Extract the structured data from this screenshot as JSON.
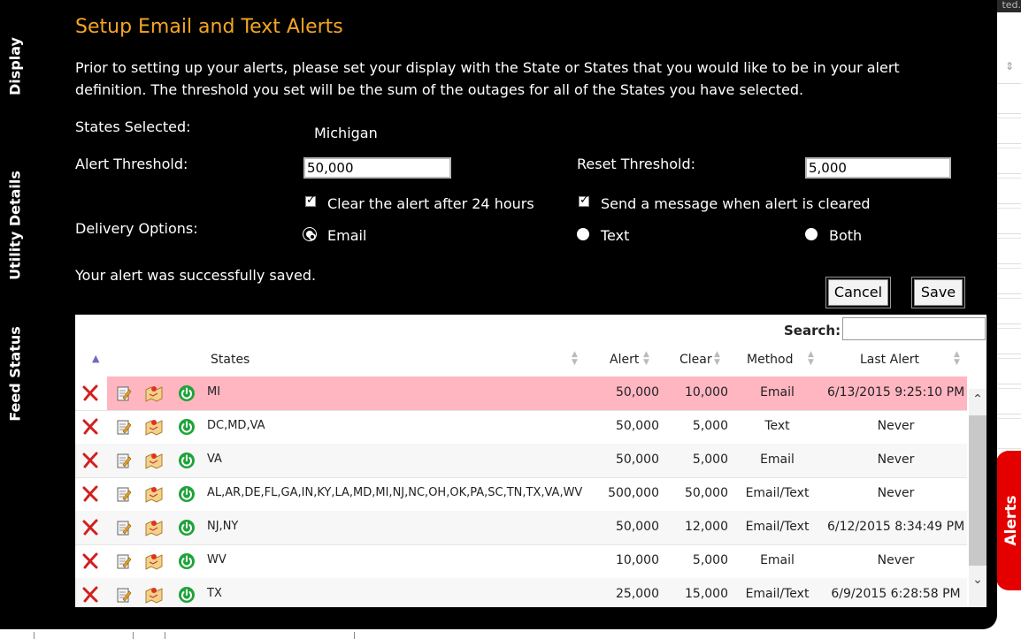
{
  "dialog": {
    "title": "Setup Email and Text Alerts",
    "intro": "Prior to setting up your alerts, please set your display with the State or States that you would like to be in your alert definition. The threshold you set will be the sum of the outages for all of the States you have selected.",
    "states_selected_label": "States Selected:",
    "states_selected_value": "Michigan",
    "alert_threshold_label": "Alert Threshold:",
    "alert_threshold_value": "50,000",
    "reset_threshold_label": "Reset Threshold:",
    "reset_threshold_value": "5,000",
    "clear_after_label": "Clear the alert after 24 hours",
    "send_cleared_label": "Send a message when alert is cleared",
    "delivery_label": "Delivery Options:",
    "delivery_options": [
      "Email",
      "Text",
      "Both"
    ],
    "delivery_selected": "Email",
    "status_message": "Your alert was successfully saved.",
    "cancel_label": "Cancel",
    "save_label": "Save"
  },
  "side_tabs": [
    "Display",
    "Utility Details",
    "Feed Status"
  ],
  "right_tab": "Alerts",
  "table": {
    "search_label": "Search:",
    "columns": [
      "States",
      "Alert",
      "Clear",
      "Method",
      "Last Alert"
    ],
    "rows": [
      {
        "states": "MI",
        "alert": "50,000",
        "clear": "10,000",
        "method": "Email",
        "last": "6/13/2015 9:25:10 PM"
      },
      {
        "states": "DC,MD,VA",
        "alert": "50,000",
        "clear": "5,000",
        "method": "Text",
        "last": "Never"
      },
      {
        "states": "VA",
        "alert": "50,000",
        "clear": "5,000",
        "method": "Email",
        "last": "Never"
      },
      {
        "states": "AL,AR,DE,FL,GA,IN,KY,LA,MD,MI,NJ,NC,OH,OK,PA,SC,TN,TX,VA,WV",
        "alert": "500,000",
        "clear": "50,000",
        "method": "Email/Text",
        "last": "Never"
      },
      {
        "states": "NJ,NY",
        "alert": "50,000",
        "clear": "12,000",
        "method": "Email/Text",
        "last": "6/12/2015 8:34:49 PM"
      },
      {
        "states": "WV",
        "alert": "10,000",
        "clear": "5,000",
        "method": "Email",
        "last": "Never"
      },
      {
        "states": "TX",
        "alert": "25,000",
        "clear": "15,000",
        "method": "Email/Text",
        "last": "6/9/2015 6:28:58 PM"
      }
    ]
  },
  "colors": {
    "title": "#f5a623",
    "highlight_row": "#ffb6c1",
    "alerts_tab": "#e50000",
    "delete_icon": "#d21f1f",
    "power_icon": "#1fa33a"
  }
}
